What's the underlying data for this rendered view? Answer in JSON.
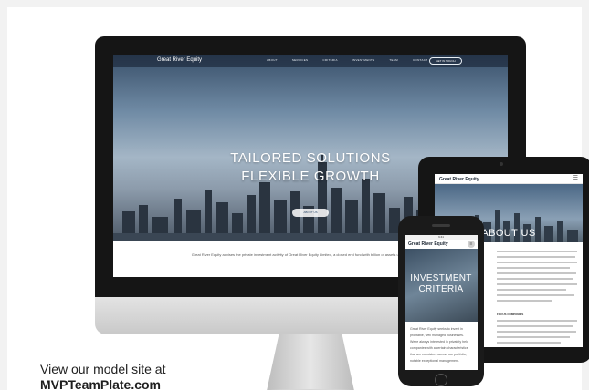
{
  "desktop_site": {
    "logo": "Great River Equity",
    "nav_links": [
      "ABOUT",
      "SERVICES",
      "CRITERIA",
      "INVESTMENTS",
      "TEAM",
      "CONTACT"
    ],
    "contact_button": "GET IN TOUCH",
    "hero_title_line1": "TAILORED SOLUTIONS",
    "hero_title_line2": "FLEXIBLE GROWTH",
    "hero_button": "ABOUT US",
    "intro_text": "Great River Equity advises the private investment activity of Great River Equity Limited, a closed end fund with billion of assets under management."
  },
  "tablet_site": {
    "logo": "Great River Equity",
    "menu_icon": "hamburger-icon",
    "hero_title": "ABOUT US",
    "subheading": "FOCUS COMPANIES"
  },
  "phone_site": {
    "status_text": "9:41",
    "logo": "Great River Equity",
    "menu_icon": "hamburger-icon",
    "hero_title_line1": "INVESTMENT",
    "hero_title_line2": "CRITERIA",
    "body_text": "Great River Equity seeks to invest in profitable, well managed businesses. We're always interested in privately held companies with a certain characteristics that are consistent across our portfolio, notable exceptional management."
  },
  "caption": {
    "line1": "View our model site at",
    "line2": "MVPTeamPlate.com"
  }
}
